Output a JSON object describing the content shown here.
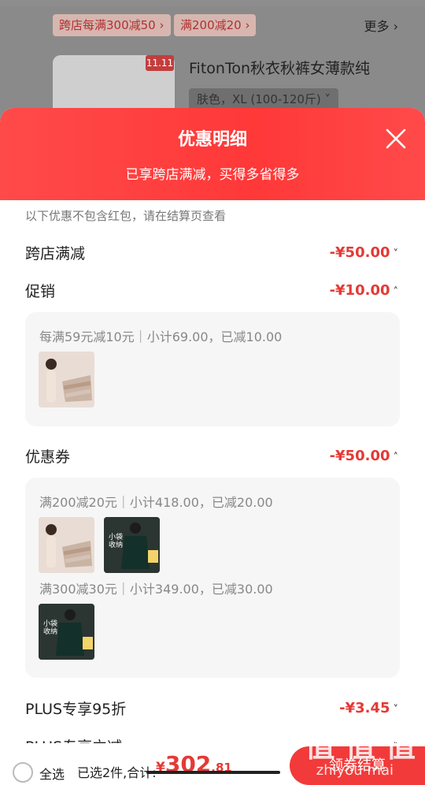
{
  "background": {
    "chips": [
      "跨店每满300减50 ›",
      "满200减20 ›"
    ],
    "more_label": "更多 ›",
    "tag_label": "11.11",
    "product_title": "FitonTon秋衣秋裤女薄款纯",
    "sku_label": "肤色，XL (100-120斤) ˅"
  },
  "sheet": {
    "title": "优惠明细",
    "subtitle": "已享跨店满减，买得多省得多",
    "note": "以下优惠不包含红包，请在结算页查看",
    "rows": [
      {
        "label": "跨店满减",
        "amount": "-¥50.00",
        "chevron": "˅"
      },
      {
        "label": "促销",
        "amount": "-¥10.00",
        "chevron": "˄"
      },
      {
        "label": "优惠券",
        "amount": "-¥50.00",
        "chevron": "˄"
      },
      {
        "label": "PLUS专享95折",
        "amount": "-¥3.45",
        "chevron": "˅"
      },
      {
        "label": "PLUS专享立减",
        "amount": "",
        "chevron": "˅"
      }
    ],
    "promo_card": {
      "line": "每满59元减10元｜小计69.00，已减10.00"
    },
    "coupon_card": {
      "line1": "满200减20元｜小计418.00，已减20.00",
      "line2": "满300减30元｜小计349.00，已减30.00"
    }
  },
  "bottom_bar": {
    "select_all": "全选",
    "summary": "已选2件,合计:",
    "price_currency": "¥",
    "price_integer": "302",
    "price_decimal": ".81",
    "checkout_label": "领券结算"
  },
  "watermark": {
    "big": "值 值 值",
    "small": "zhiyou mai"
  }
}
